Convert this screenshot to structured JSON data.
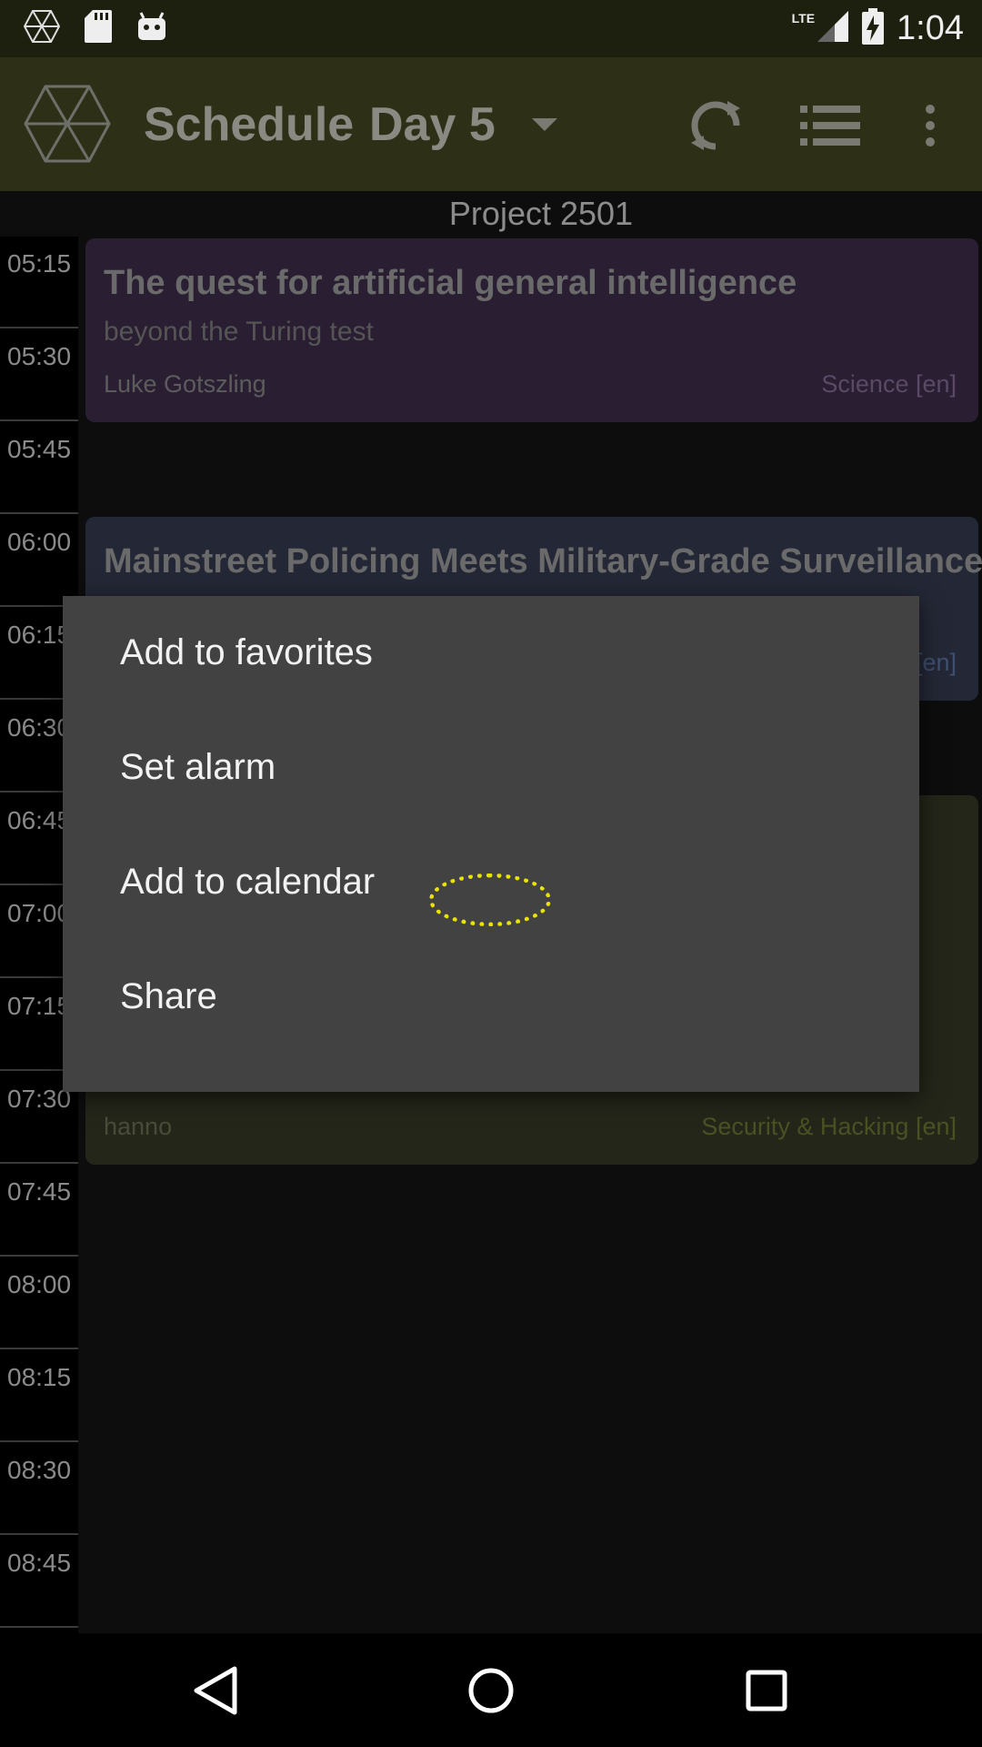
{
  "status_bar": {
    "network": "LTE",
    "time": "1:04",
    "icons": [
      "hexagon-app-icon",
      "sd-card-icon",
      "android-icon",
      "signal-icon",
      "battery-charging-icon"
    ]
  },
  "app_bar": {
    "title": "Schedule",
    "day": "Day 5",
    "actions": [
      "refresh-icon",
      "list-icon",
      "overflow-menu-icon"
    ]
  },
  "room": "Project 2501",
  "time_slots": [
    "05:15",
    "05:30",
    "05:45",
    "06:00",
    "06:15",
    "06:30",
    "06:45",
    "07:00",
    "07:15",
    "07:30",
    "07:45",
    "08:00",
    "08:15",
    "08:30",
    "08:45"
  ],
  "events": [
    {
      "title": "The quest for artificial general intelligence",
      "subtitle": "beyond the Turing test",
      "speaker": "Luke Gotszling",
      "track": "Science [en]"
    },
    {
      "title": "Mainstreet Policing Meets Military-Grade Surveillance",
      "subtitle": "",
      "speaker": "",
      "track": "[en]"
    },
    {
      "title": "",
      "subtitle": "",
      "speaker": "hanno",
      "track": "Security & Hacking [en]"
    }
  ],
  "context_menu": {
    "items": [
      "Add to favorites",
      "Set alarm",
      "Add to calendar",
      "Share"
    ]
  },
  "colors": {
    "status_bar": "#1d200e",
    "app_bar": "#2d3017",
    "dialog": "#424242",
    "touch_indicator": "#e8e400"
  }
}
